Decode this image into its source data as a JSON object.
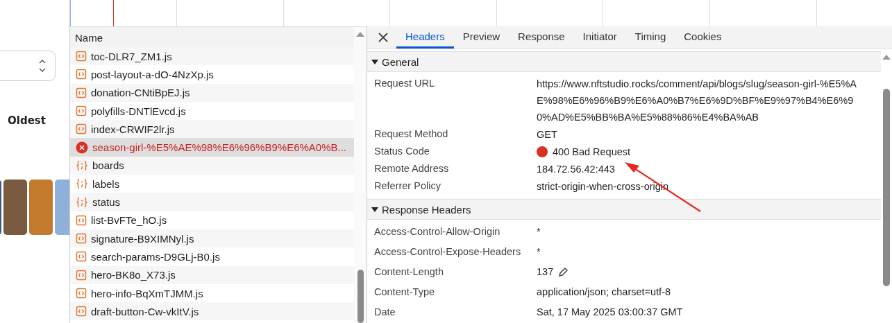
{
  "page": {
    "sort_label": "Oldest"
  },
  "request_list": {
    "column": "Name",
    "rows": [
      {
        "name": "toc-DLR7_ZM1.js",
        "kind": "script",
        "selected": false
      },
      {
        "name": "post-layout-a-dO-4NzXp.js",
        "kind": "script",
        "selected": false
      },
      {
        "name": "donation-CNtiBpEJ.js",
        "kind": "script",
        "selected": false
      },
      {
        "name": "polyfills-DNTlEvcd.js",
        "kind": "script",
        "selected": false
      },
      {
        "name": "index-CRWIF2lr.js",
        "kind": "script",
        "selected": false
      },
      {
        "name": "season-girl-%E5%AE%98%E6%96%B9%E6%A0%B...",
        "kind": "error",
        "selected": true
      },
      {
        "name": "boards",
        "kind": "fetch",
        "selected": false
      },
      {
        "name": "labels",
        "kind": "fetch",
        "selected": false
      },
      {
        "name": "status",
        "kind": "fetch",
        "selected": false
      },
      {
        "name": "list-BvFTe_hO.js",
        "kind": "script",
        "selected": false
      },
      {
        "name": "signature-B9XIMNyl.js",
        "kind": "script",
        "selected": false
      },
      {
        "name": "search-params-D9GLj-B0.js",
        "kind": "script",
        "selected": false
      },
      {
        "name": "hero-BK8o_X73.js",
        "kind": "script",
        "selected": false
      },
      {
        "name": "hero-info-BqXmTJMM.js",
        "kind": "script",
        "selected": false
      },
      {
        "name": "draft-button-Cw-vkItV.js",
        "kind": "script",
        "selected": false
      }
    ]
  },
  "detail": {
    "tabs": [
      {
        "label": "Headers",
        "selected": true
      },
      {
        "label": "Preview",
        "selected": false
      },
      {
        "label": "Response",
        "selected": false
      },
      {
        "label": "Initiator",
        "selected": false
      },
      {
        "label": "Timing",
        "selected": false
      },
      {
        "label": "Cookies",
        "selected": false
      }
    ],
    "sections": [
      {
        "title": "General",
        "expanded": true,
        "rows": [
          {
            "name": "Request URL",
            "value": "https://www.nftstudio.rocks/comment/api/blogs/slug/season-girl-%E5%AE%98%E6%96%B9%E6%A0%B7%E6%9D%BF%E9%97%B4%E6%90%AD%E5%BB%BA%E5%88%86%E4%BA%AB"
          },
          {
            "name": "Request Method",
            "value": "GET"
          },
          {
            "name": "Status Code",
            "value": "400 Bad Request",
            "color": "#d93025"
          },
          {
            "name": "Remote Address",
            "value": "184.72.56.42:443"
          },
          {
            "name": "Referrer Policy",
            "value": "strict-origin-when-cross-origin"
          }
        ]
      },
      {
        "title": "Response Headers",
        "expanded": true,
        "rows": [
          {
            "name": "Access-Control-Allow-Origin",
            "value": "*"
          },
          {
            "name": "Access-Control-Expose-Headers",
            "value": "*"
          },
          {
            "name": "Content-Length",
            "value": "137",
            "editable": true
          },
          {
            "name": "Content-Type",
            "value": "application/json; charset=utf-8"
          },
          {
            "name": "Date",
            "value": "Sat, 17 May 2025 03:00:37 GMT"
          }
        ]
      }
    ]
  }
}
